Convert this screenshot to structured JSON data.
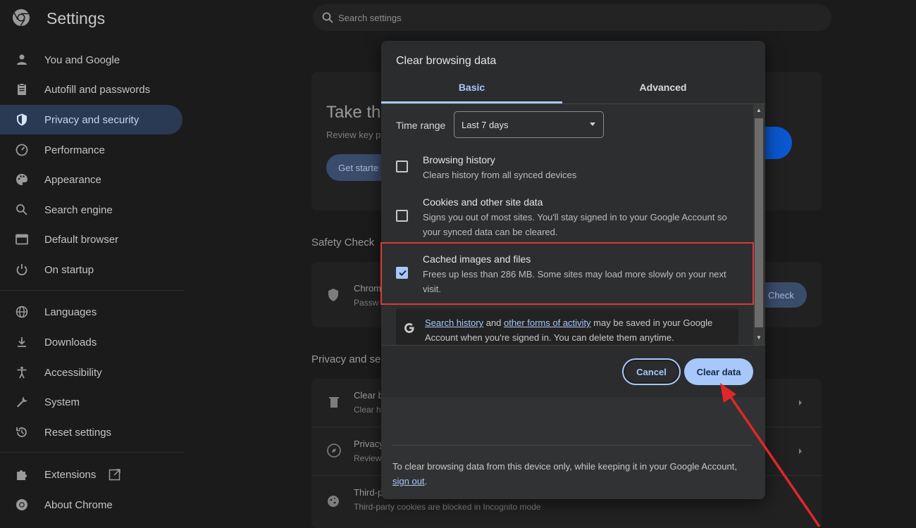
{
  "header": {
    "title": "Settings",
    "search_placeholder": "Search settings"
  },
  "sidebar": {
    "items": [
      {
        "label": "You and Google",
        "icon": "person-icon"
      },
      {
        "label": "Autofill and passwords",
        "icon": "clipboard-icon"
      },
      {
        "label": "Privacy and security",
        "icon": "shield-icon",
        "active": true
      },
      {
        "label": "Performance",
        "icon": "gauge-icon"
      },
      {
        "label": "Appearance",
        "icon": "palette-icon"
      },
      {
        "label": "Search engine",
        "icon": "search-icon"
      },
      {
        "label": "Default browser",
        "icon": "browser-icon"
      },
      {
        "label": "On startup",
        "icon": "power-icon"
      },
      {
        "label": "Languages",
        "icon": "globe-icon"
      },
      {
        "label": "Downloads",
        "icon": "download-icon"
      },
      {
        "label": "Accessibility",
        "icon": "accessibility-icon"
      },
      {
        "label": "System",
        "icon": "wrench-icon"
      },
      {
        "label": "Reset settings",
        "icon": "reset-icon"
      },
      {
        "label": "Extensions",
        "icon": "puzzle-icon"
      },
      {
        "label": "About Chrome",
        "icon": "chrome-icon"
      }
    ]
  },
  "background": {
    "guide_title": "Take the",
    "guide_desc": "Review key p",
    "get_started": "Get starte",
    "safety_check": "Safety Check",
    "chrome_row_title": "Chrom",
    "chrome_row_sub": "Passw",
    "check_button": "Check",
    "privacy_section": "Privacy and sec",
    "rows": [
      {
        "title": "Clear b",
        "sub": "Clear h"
      },
      {
        "title": "Privacy",
        "sub": "Review"
      },
      {
        "title": "Third-p",
        "sub": "Third-party cookies are blocked in Incognito mode"
      }
    ]
  },
  "dialog": {
    "title": "Clear browsing data",
    "tabs": [
      "Basic",
      "Advanced"
    ],
    "time_range_label": "Time range",
    "time_range_value": "Last 7 days",
    "options": [
      {
        "title": "Browsing history",
        "desc": "Clears history from all synced devices",
        "checked": false
      },
      {
        "title": "Cookies and other site data",
        "desc": "Signs you out of most sites. You'll stay signed in to your Google Account so your synced data can be cleared.",
        "checked": false
      },
      {
        "title": "Cached images and files",
        "desc": "Frees up less than 286 MB. Some sites may load more slowly on your next visit.",
        "checked": true
      }
    ],
    "note": {
      "link1": "Search history",
      "and": " and ",
      "link2": "other forms of activity",
      "rest": " may be saved in your Google Account when you're signed in. You can delete them anytime."
    },
    "cancel_label": "Cancel",
    "clear_label": "Clear data",
    "footer": {
      "text": "To clear browsing data from this device only, while keeping it in your Google Account, ",
      "link": "sign out",
      "end": "."
    }
  },
  "colors": {
    "accent": "#a8c7fa",
    "annotation": "#d83a3a"
  }
}
